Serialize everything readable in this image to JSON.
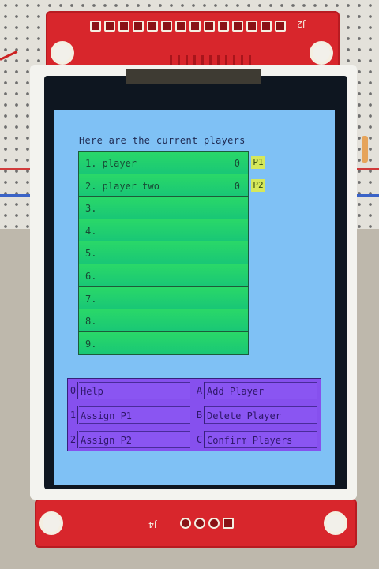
{
  "pcb": {
    "top_label": "J2",
    "bottom_label": "J4"
  },
  "screen": {
    "title": "Here are the current players",
    "players": [
      {
        "label": "1. player",
        "score": "0",
        "tag": "P1"
      },
      {
        "label": "2. player two",
        "score": "0",
        "tag": "P2"
      },
      {
        "label": "3.",
        "score": ""
      },
      {
        "label": "4.",
        "score": ""
      },
      {
        "label": "5.",
        "score": ""
      },
      {
        "label": "6.",
        "score": ""
      },
      {
        "label": "7.",
        "score": ""
      },
      {
        "label": "8.",
        "score": ""
      },
      {
        "label": "9.",
        "score": ""
      }
    ],
    "menu": [
      {
        "key": "0",
        "label": "Help"
      },
      {
        "key": "A",
        "label": "Add Player"
      },
      {
        "key": "1",
        "label": "Assign P1"
      },
      {
        "key": "B",
        "label": "Delete Player"
      },
      {
        "key": "2",
        "label": "Assign P2"
      },
      {
        "key": "C",
        "label": "Confirm Players"
      }
    ]
  },
  "colors": {
    "screen_bg": "#7fc1f5",
    "player_row": "#1fd06e",
    "menu_bg": "#8650ee",
    "pcb": "#d8262c"
  }
}
